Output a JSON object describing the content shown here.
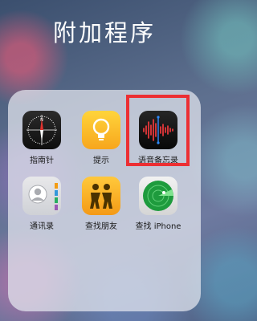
{
  "folder": {
    "title": "附加程序",
    "apps": [
      {
        "label": "指南针",
        "icon": "compass-icon"
      },
      {
        "label": "提示",
        "icon": "lightbulb-icon"
      },
      {
        "label": "语音备忘录",
        "icon": "voice-memo-waveform-icon"
      },
      {
        "label": "通讯录",
        "icon": "contacts-icon"
      },
      {
        "label": "查找朋友",
        "icon": "find-friends-icon"
      },
      {
        "label": "查找 iPhone",
        "icon": "radar-icon"
      }
    ]
  },
  "highlight": {
    "target": "语音备忘录",
    "color": "#ec2f33"
  }
}
